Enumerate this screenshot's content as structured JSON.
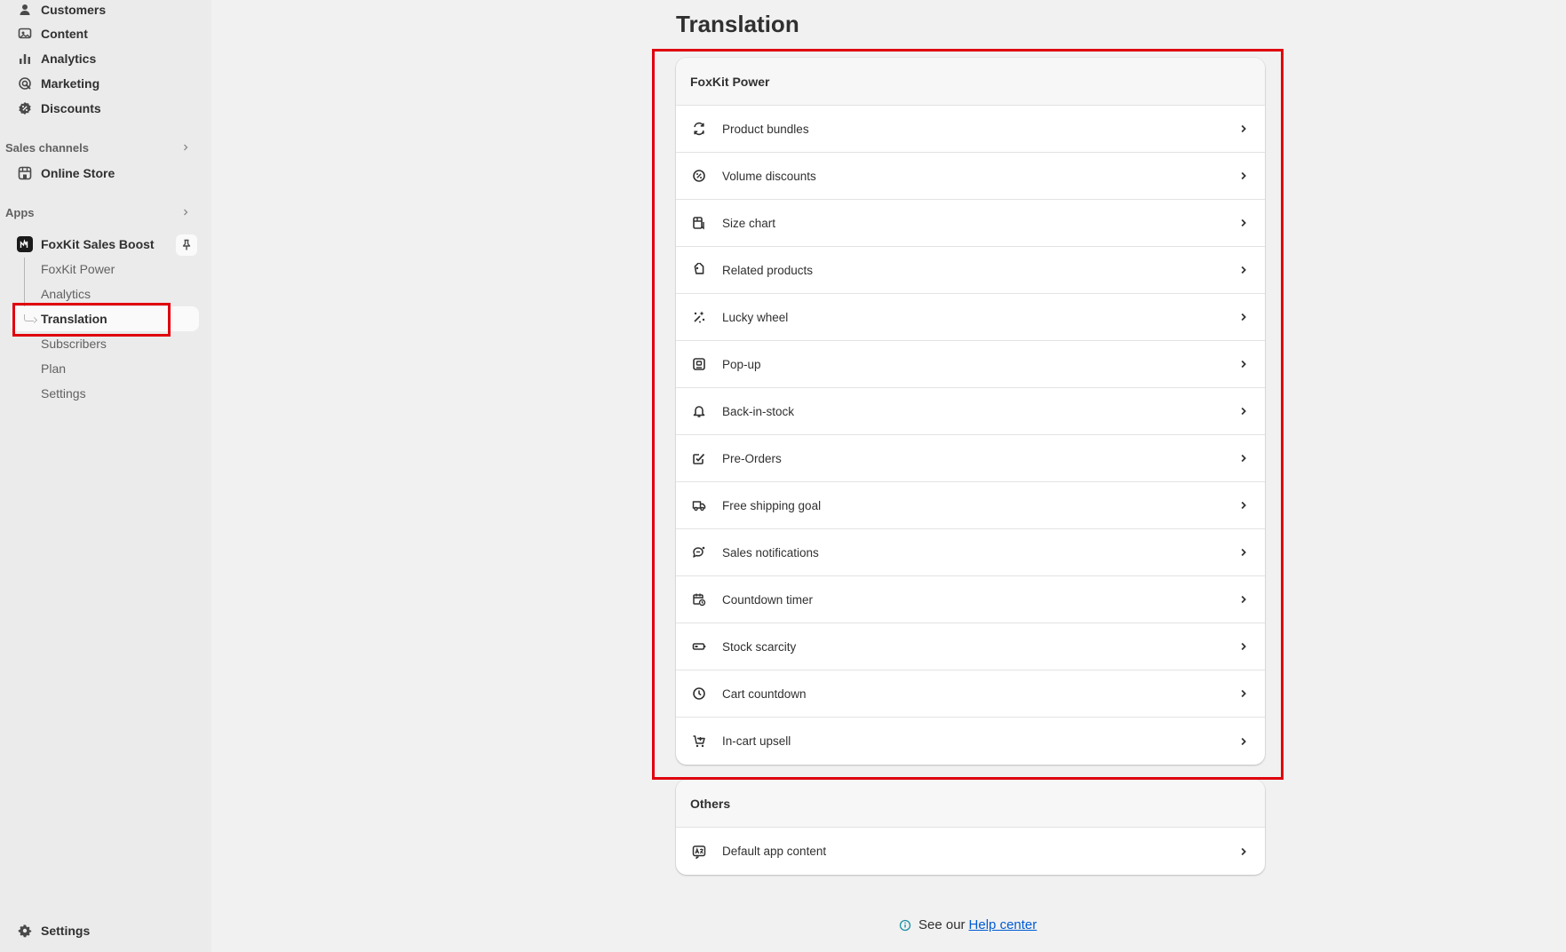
{
  "sidebar": {
    "nav": [
      {
        "label": "Customers",
        "icon": "person-icon"
      },
      {
        "label": "Content",
        "icon": "content-icon"
      },
      {
        "label": "Analytics",
        "icon": "bar-chart-icon"
      },
      {
        "label": "Marketing",
        "icon": "target-icon"
      },
      {
        "label": "Discounts",
        "icon": "discount-icon"
      }
    ],
    "sales_channels": {
      "label": "Sales channels",
      "items": [
        {
          "label": "Online Store",
          "icon": "store-icon"
        }
      ]
    },
    "apps": {
      "label": "Apps",
      "app_name": "FoxKit Sales Boost",
      "subitems": [
        {
          "label": "FoxKit Power"
        },
        {
          "label": "Analytics"
        },
        {
          "label": "Translation",
          "active": true
        },
        {
          "label": "Subscribers"
        },
        {
          "label": "Plan"
        },
        {
          "label": "Settings"
        }
      ]
    },
    "settings_label": "Settings"
  },
  "main": {
    "title": "Translation",
    "foxkit_card": {
      "heading": "FoxKit Power",
      "rows": [
        {
          "label": "Product bundles",
          "icon": "bundle-icon"
        },
        {
          "label": "Volume discounts",
          "icon": "discount-badge-icon"
        },
        {
          "label": "Size chart",
          "icon": "size-chart-icon"
        },
        {
          "label": "Related products",
          "icon": "tag-icon"
        },
        {
          "label": "Lucky wheel",
          "icon": "sparkle-icon"
        },
        {
          "label": "Pop-up",
          "icon": "popup-icon"
        },
        {
          "label": "Back-in-stock",
          "icon": "bell-icon"
        },
        {
          "label": "Pre-Orders",
          "icon": "order-check-icon"
        },
        {
          "label": "Free shipping goal",
          "icon": "truck-icon"
        },
        {
          "label": "Sales notifications",
          "icon": "chat-icon"
        },
        {
          "label": "Countdown timer",
          "icon": "calendar-clock-icon"
        },
        {
          "label": "Stock scarcity",
          "icon": "battery-icon"
        },
        {
          "label": "Cart countdown",
          "icon": "clock-icon"
        },
        {
          "label": "In-cart upsell",
          "icon": "cart-plus-icon"
        }
      ]
    },
    "others_card": {
      "heading": "Others",
      "rows": [
        {
          "label": "Default app content",
          "icon": "translate-icon"
        }
      ]
    },
    "footer": {
      "text": "See our",
      "link": "Help center"
    }
  }
}
